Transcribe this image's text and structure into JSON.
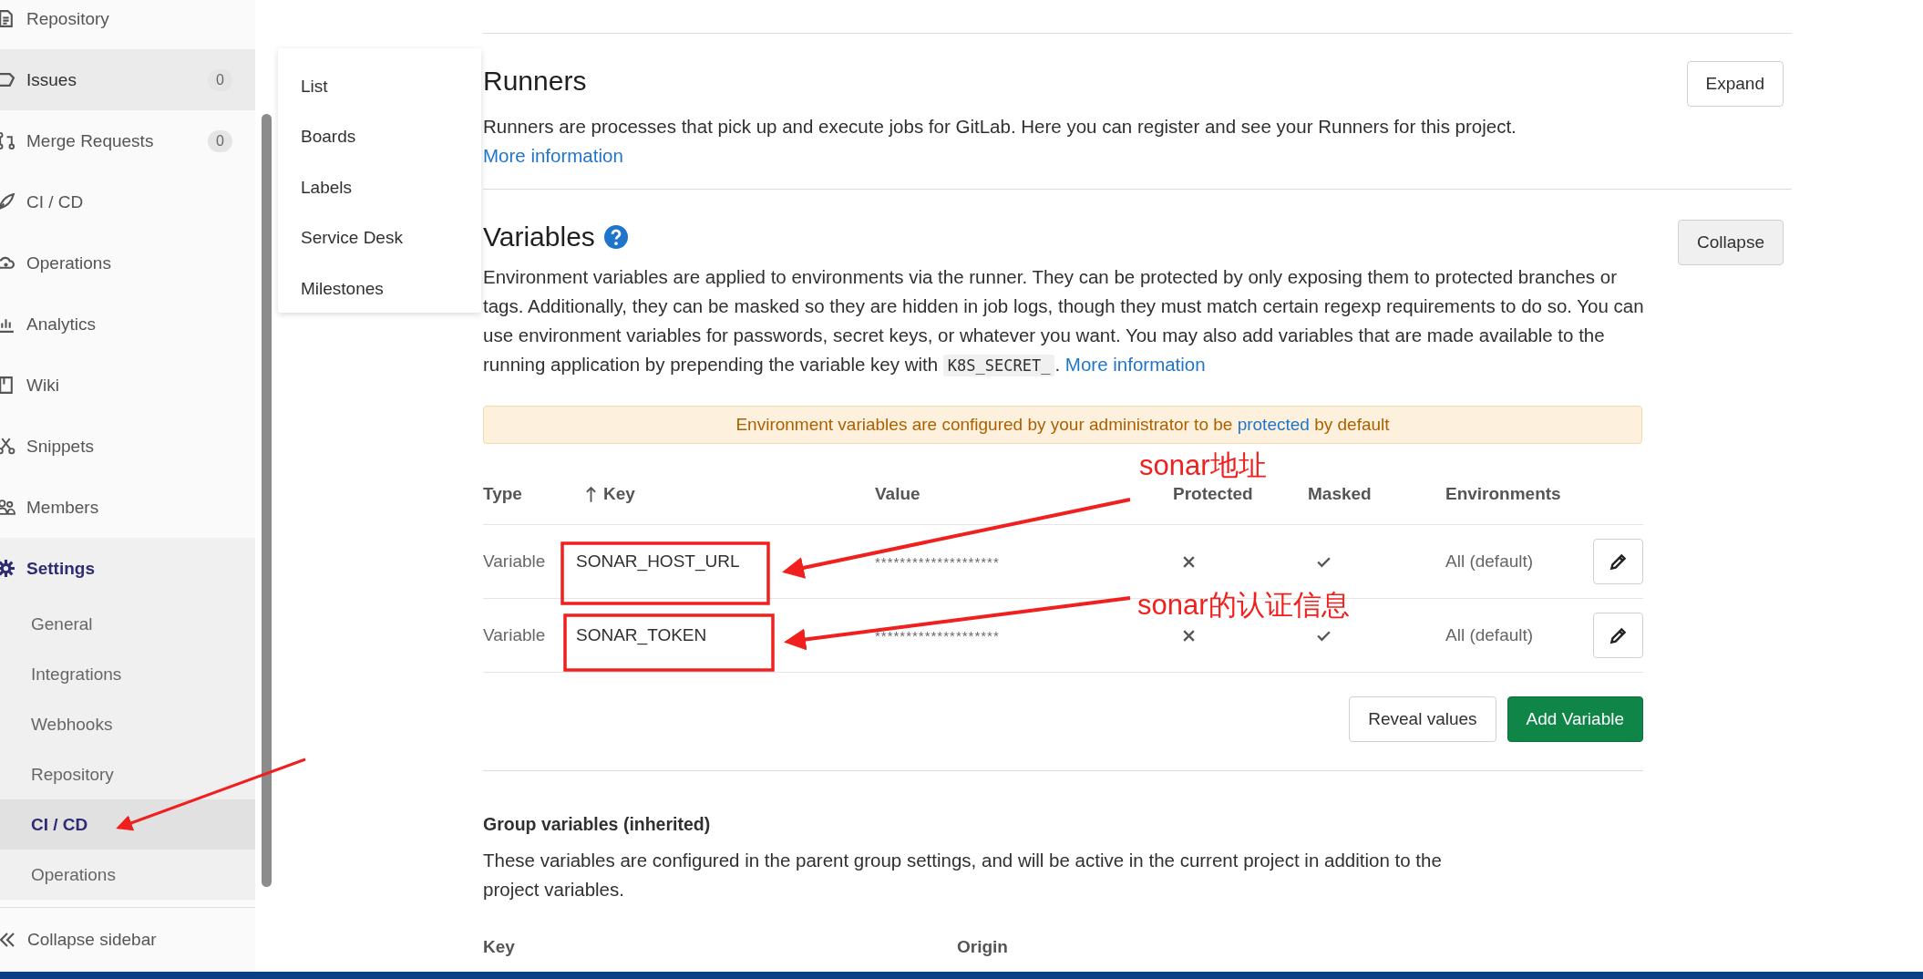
{
  "sidebar": {
    "items": [
      {
        "label": "Repository",
        "selected": false,
        "hovered": false
      },
      {
        "label": "Issues",
        "count": "0",
        "selected": false,
        "hovered": true
      },
      {
        "label": "Merge Requests",
        "count": "0",
        "selected": false,
        "hovered": false
      },
      {
        "label": "CI / CD",
        "selected": false,
        "hovered": false
      },
      {
        "label": "Operations",
        "selected": false,
        "hovered": false
      },
      {
        "label": "Analytics",
        "selected": false,
        "hovered": false
      },
      {
        "label": "Wiki",
        "selected": false,
        "hovered": false
      },
      {
        "label": "Snippets",
        "selected": false,
        "hovered": false
      },
      {
        "label": "Members",
        "selected": false,
        "hovered": false
      },
      {
        "label": "Settings",
        "selected": true,
        "hovered": false,
        "children": [
          {
            "label": "General",
            "selected": false
          },
          {
            "label": "Integrations",
            "selected": false
          },
          {
            "label": "Webhooks",
            "selected": false
          },
          {
            "label": "Repository",
            "selected": false
          },
          {
            "label": "CI / CD",
            "selected": true
          },
          {
            "label": "Operations",
            "selected": false
          }
        ]
      }
    ],
    "collapse": "Collapse sidebar"
  },
  "dropdown": {
    "items": [
      "List",
      "Boards",
      "Labels",
      "Service Desk",
      "Milestones"
    ]
  },
  "runners": {
    "title": "Runners",
    "description": "Runners are processes that pick up and execute jobs for GitLab. Here you can register and see your Runners for this project.",
    "link": "More information",
    "button": "Expand"
  },
  "variables": {
    "title": "Variables",
    "description": "Environment variables are applied to environments via the runner. They can be protected by only exposing them to protected branches or tags. Additionally, they can be masked so they are hidden in job logs, though they must match certain regexp requirements to do so. You can use environment variables for passwords, secret keys, or whatever you want. You may also add variables that are made available to the running application by prepending the variable key with",
    "code": "K8S_SECRET_",
    "code_after": ".",
    "link": "More information",
    "button": "Collapse",
    "alert": {
      "before": "Environment variables are configured by your administrator to be",
      "link": "protected",
      "after": "by default"
    },
    "columns": [
      {
        "label": "Type",
        "sorted": false
      },
      {
        "label": "Key",
        "sorted": true
      },
      {
        "label": "Value",
        "sorted": false
      },
      {
        "label": "Protected",
        "sorted": false
      },
      {
        "label": "Masked",
        "sorted": false
      },
      {
        "label": "Environments",
        "sorted": false
      }
    ],
    "rows": [
      {
        "type": "Variable",
        "key": "SONAR_HOST_URL",
        "value": "********************",
        "protected": false,
        "masked": true,
        "environments": "All (default)"
      },
      {
        "type": "Variable",
        "key": "SONAR_TOKEN",
        "value": "********************",
        "protected": false,
        "masked": true,
        "environments": "All (default)"
      }
    ],
    "buttons": [
      "Reveal values",
      "Add Variable"
    ]
  },
  "group_variables": {
    "title": "Group variables (inherited)",
    "description": "These variables are configured in the parent group settings, and will be active in the current project in addition to the project variables.",
    "columns": [
      "Key",
      "Origin"
    ]
  },
  "annotations": [
    {
      "text": "sonar地址"
    },
    {
      "text": "sonar的认证信息"
    }
  ]
}
